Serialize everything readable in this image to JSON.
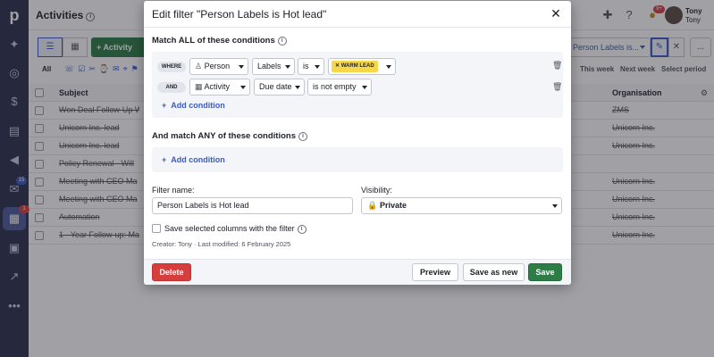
{
  "app": {
    "logo": "p",
    "title": "Activities",
    "user": {
      "name": "Tony",
      "subname": "Tony"
    },
    "notification_badge": "9+"
  },
  "rail": {
    "mail_badge": "15",
    "activities_badge": "1"
  },
  "toolbar": {
    "add_activity_label": "Activity",
    "filter_label": "Person Labels is...",
    "more_label": "..."
  },
  "filters": {
    "all_label": "All",
    "periods": [
      "This week",
      "Next week",
      "Select period"
    ]
  },
  "table": {
    "columns": {
      "subject": "Subject",
      "organisation": "Organisation"
    },
    "rows": [
      {
        "subject": "Won Deal Follow-Up W",
        "organisation": "ZMS"
      },
      {
        "subject": "Unicorn Inc. lead",
        "organisation": "Unicorn Inc."
      },
      {
        "subject": "Unicorn Inc. lead",
        "organisation": "Unicorn Inc."
      },
      {
        "subject": "Policy Renewal - Will",
        "organisation": ""
      },
      {
        "subject": "Meeting with CEO Ma",
        "organisation": "Unicorn Inc."
      },
      {
        "subject": "Meeting with CEO Ma",
        "organisation": "Unicorn Inc."
      },
      {
        "subject": "Automation",
        "organisation": "Unicorn Inc."
      },
      {
        "subject": "1 - Year Follow-up: Ma",
        "organisation": "Unicorn Inc."
      }
    ]
  },
  "modal": {
    "title": "Edit filter \"Person Labels is Hot lead\"",
    "all_conditions_label": "Match ALL of these conditions",
    "any_conditions_label": "And match ANY of these conditions",
    "conditions": [
      {
        "conj": "WHERE",
        "entity": "Person",
        "field": "Labels",
        "operator": "is",
        "value": "WARM LEAD"
      },
      {
        "conj": "AND",
        "entity": "Activity",
        "field": "Due date",
        "operator": "is not empty",
        "value": ""
      }
    ],
    "add_condition_label": "Add condition",
    "filter_name_label": "Filter name:",
    "filter_name_value": "Person Labels is Hot lead",
    "visibility_label": "Visibility:",
    "visibility_value": "Private",
    "save_columns_label": "Save selected columns with the filter",
    "meta": "Creator: Tony · Last modified: 6 February 2025",
    "buttons": {
      "delete": "Delete",
      "preview": "Preview",
      "save_as_new": "Save as new",
      "save": "Save"
    }
  },
  "colors": {
    "rail": "#2b2f4e",
    "primary_green": "#2e7d46",
    "danger_red": "#d63e3e",
    "link_blue": "#3a5bc7",
    "label_yellow": "#f7d84a"
  }
}
